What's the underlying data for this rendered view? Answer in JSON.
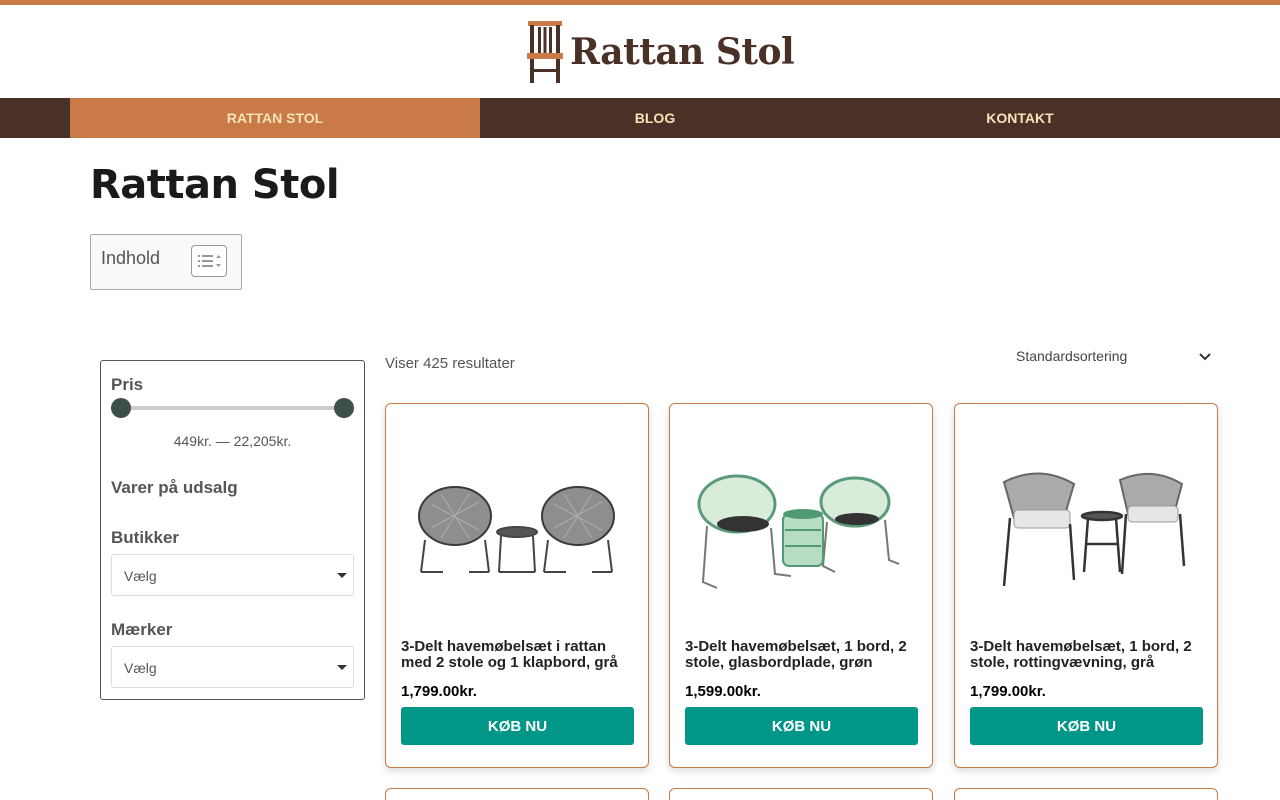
{
  "site": {
    "logo_text": "Rattan Stol",
    "accent_color": "#c97a46",
    "nav_color": "#4a3128",
    "button_color": "#009688"
  },
  "nav": {
    "items": [
      {
        "label": "RATTAN STOL",
        "active": true
      },
      {
        "label": "BLOG",
        "active": false
      },
      {
        "label": "KONTAKT",
        "active": false
      }
    ]
  },
  "page": {
    "title": "Rattan Stol",
    "toc_label": "Indhold"
  },
  "filters": {
    "price_heading": "Pris",
    "price_range": "449kr. — 22,205kr.",
    "sale_heading": "Varer på udsalg",
    "stores_heading": "Butikker",
    "stores_value": "Vælg",
    "brands_heading": "Mærker",
    "brands_value": "Vælg"
  },
  "results": {
    "count_text": "Viser 425 resultater",
    "sort_value": "Standardsortering"
  },
  "products": [
    {
      "title": "3-Delt havemøbelsæt i rattan med 2 stole og 1 klapbord, grå",
      "price": "1,799.00kr.",
      "button": "KØB NU",
      "icon": "rattan-chairs-grey-image"
    },
    {
      "title": "3-Delt havemøbelsæt, 1 bord, 2 stole, glasbordplade, grøn",
      "price": "1,599.00kr.",
      "button": "KØB NU",
      "icon": "rattan-chairs-green-image"
    },
    {
      "title": "3-Delt havemøbelsæt, 1 bord, 2 stole, rottingvævning, grå",
      "price": "1,799.00kr.",
      "button": "KØB NU",
      "icon": "rattan-chairs-light-grey-image"
    }
  ]
}
